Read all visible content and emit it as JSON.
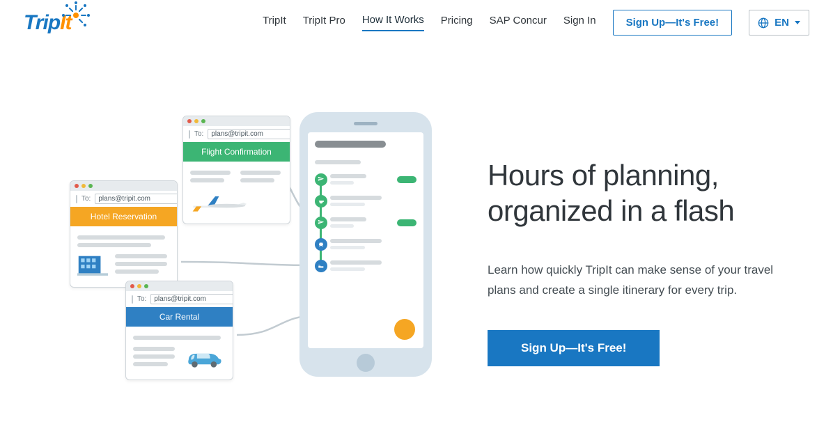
{
  "nav": {
    "items": [
      {
        "label": "TripIt"
      },
      {
        "label": "TripIt Pro"
      },
      {
        "label": "How It Works"
      },
      {
        "label": "Pricing"
      },
      {
        "label": "SAP Concur"
      },
      {
        "label": "Sign In"
      }
    ],
    "signup_label": "Sign Up—It's Free!",
    "lang_label": "EN"
  },
  "emails": {
    "to_label": "To:",
    "address": "plans@tripit.com",
    "flight_band": "Flight Confirmation",
    "hotel_band": "Hotel Reservation",
    "car_band": "Car Rental"
  },
  "hero": {
    "heading": "Hours of planning, organized in a flash",
    "lead": "Learn how quickly TripIt can make sense of your travel plans and create a single itinerary for every trip.",
    "cta": "Sign Up—It's Free!"
  }
}
